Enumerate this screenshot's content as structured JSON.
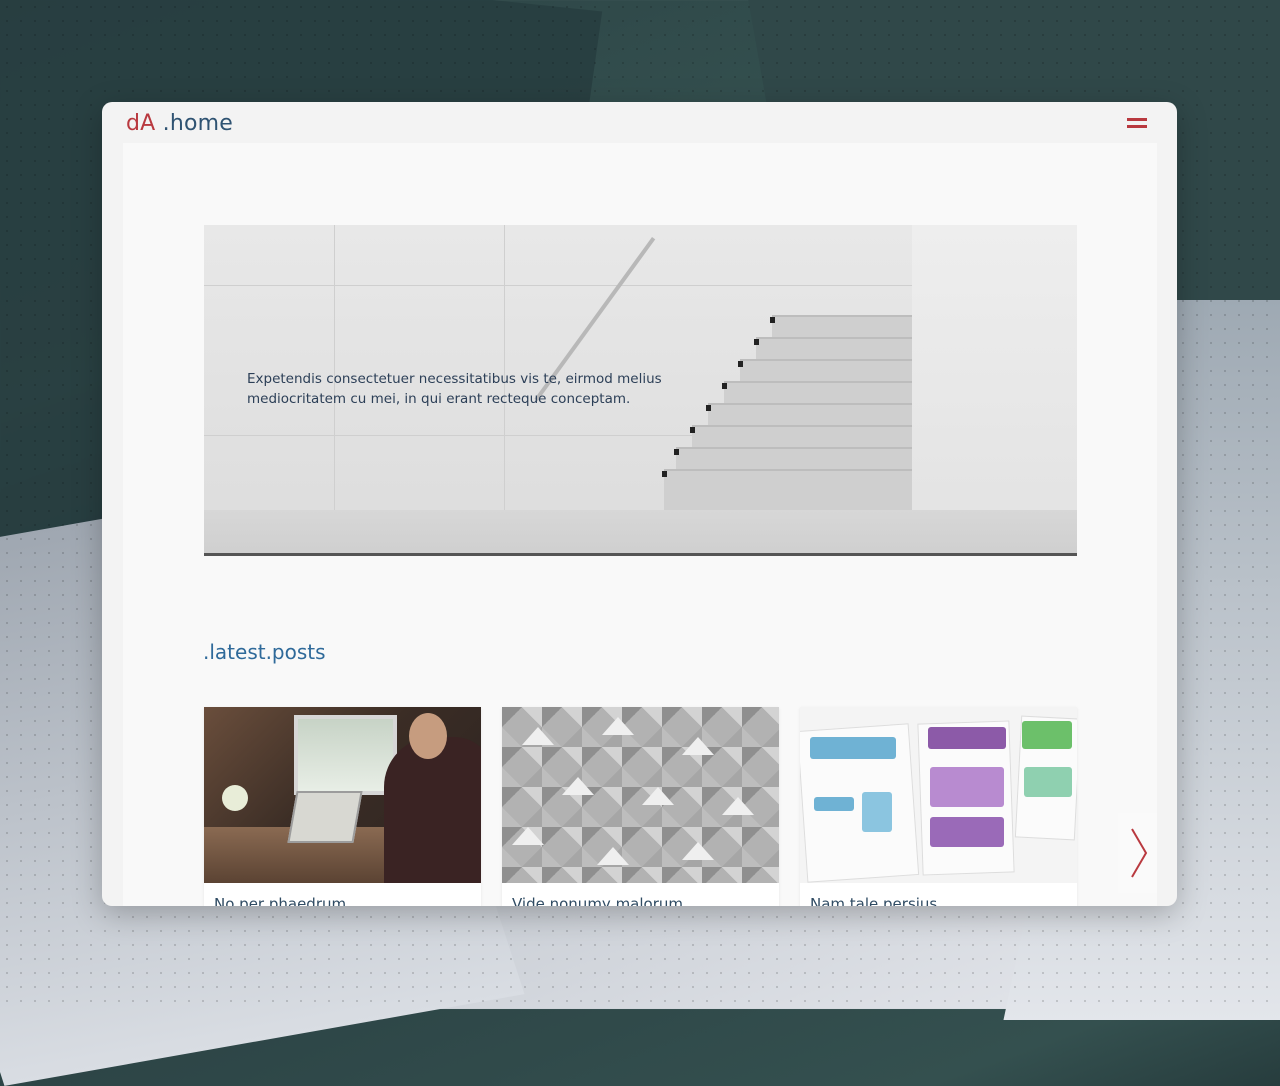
{
  "header": {
    "logo_mark": "dA",
    "logo_text": ".home",
    "menu_icon": "hamburger-icon"
  },
  "hero": {
    "text": "Expetendis consectetuer necessitatibus vis te, eirmod melius mediocritatem cu mei, in qui erant recteque conceptam."
  },
  "latest_posts": {
    "title": ".latest.posts",
    "posts": [
      {
        "title": "No per phaedrum",
        "image": "office-laptop-photo"
      },
      {
        "title": "Vide nonumy malorum",
        "image": "geometric-pattern-photo"
      },
      {
        "title": "Nam tale persius",
        "image": "wireframe-sketches-photo"
      }
    ],
    "next_icon": "chevron-right-icon"
  },
  "colors": {
    "brand_red": "#b9393f",
    "brand_blue": "#2f5372",
    "section_title": "#2f6a9a"
  }
}
